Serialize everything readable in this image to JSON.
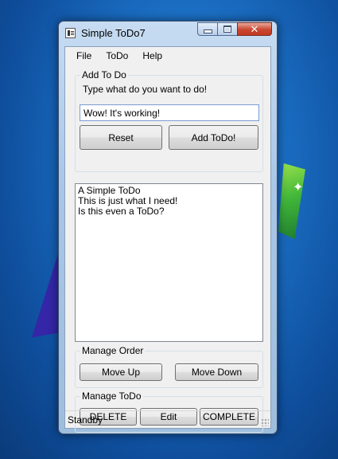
{
  "window": {
    "title": "Simple ToDo7"
  },
  "menu": [
    "File",
    "ToDo",
    "Help"
  ],
  "add_group": {
    "label": "Add To Do",
    "prompt": "Type what do you want to do!",
    "input_value": "Wow! It's working!",
    "reset_label": "Reset",
    "add_label": "Add ToDo!"
  },
  "todo_list": [
    "A Simple ToDo",
    "This is just what I need!",
    "Is this even a ToDo?"
  ],
  "order_group": {
    "label": "Manage Order",
    "move_up_label": "Move Up",
    "move_down_label": "Move Down"
  },
  "manage_group": {
    "label": "Manage ToDo",
    "delete_label": "DELETE",
    "edit_label": "Edit",
    "complete_label": "COMPLETE"
  },
  "status": "Standby",
  "icons": {
    "app": "notepad-icon",
    "minimize": "minimize-icon",
    "maximize": "maximize-icon",
    "close": "close-icon"
  }
}
